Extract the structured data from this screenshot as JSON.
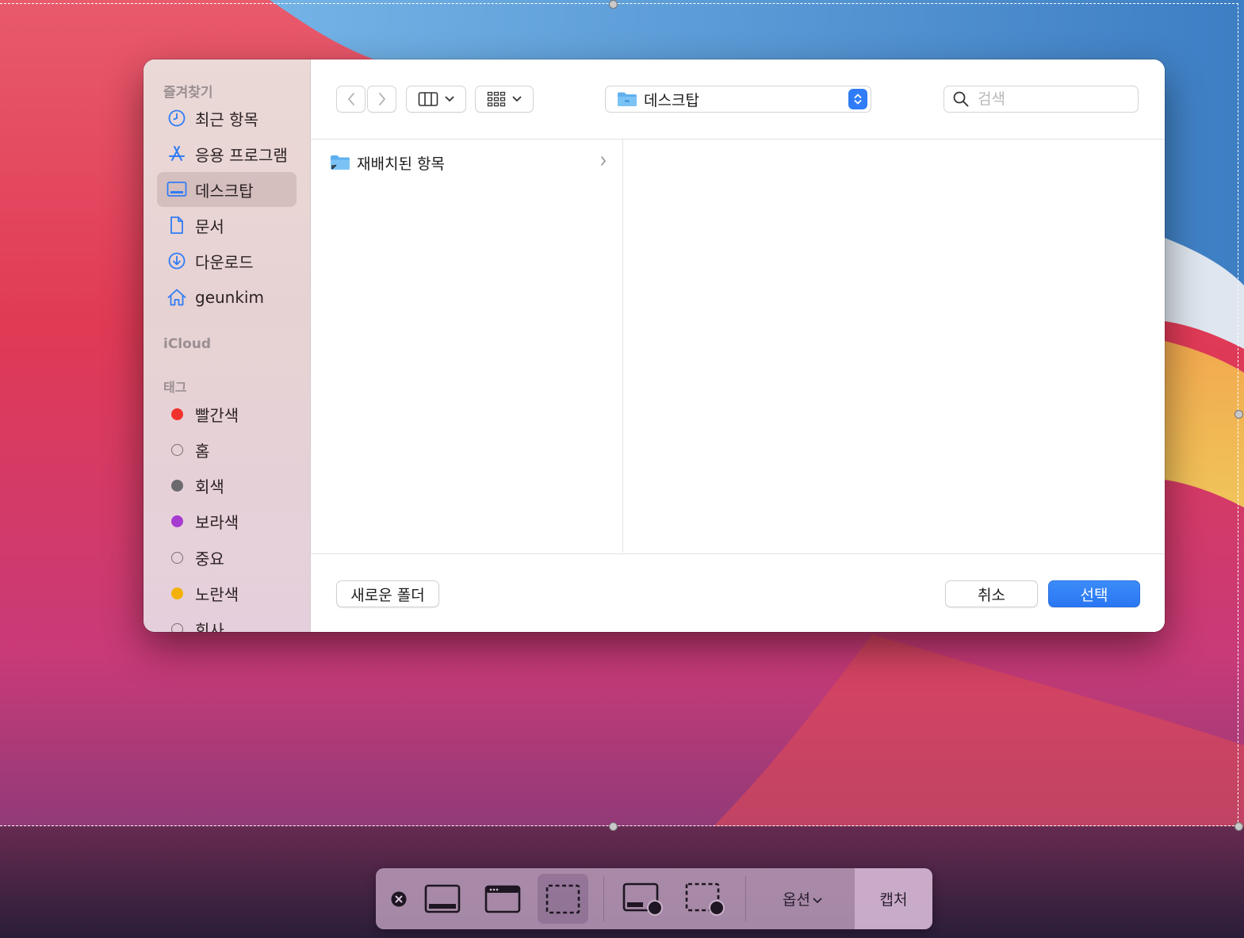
{
  "sidebar": {
    "favorites_header": "즐겨찾기",
    "favorites": [
      {
        "label": "최근 항목",
        "icon": "clock-icon"
      },
      {
        "label": "응용 프로그램",
        "icon": "app-store-icon"
      },
      {
        "label": "데스크탑",
        "icon": "desktop-icon",
        "selected": true
      },
      {
        "label": "문서",
        "icon": "document-icon"
      },
      {
        "label": "다운로드",
        "icon": "download-icon"
      },
      {
        "label": "geunkim",
        "icon": "home-icon"
      }
    ],
    "icloud_header": "iCloud",
    "tags_header": "태그",
    "tags": [
      {
        "label": "빨간색",
        "color": "#f0322c"
      },
      {
        "label": "홈",
        "color": ""
      },
      {
        "label": "회색",
        "color": "#6b6a6f"
      },
      {
        "label": "보라색",
        "color": "#a63bd0"
      },
      {
        "label": "중요",
        "color": ""
      },
      {
        "label": "노란색",
        "color": "#f2b104"
      },
      {
        "label": "회사",
        "color": ""
      }
    ]
  },
  "toolbar": {
    "path_label": "데스크탑",
    "search_placeholder": "검색"
  },
  "browser": {
    "items": [
      {
        "label": "재배치된 항목",
        "icon": "folder-alias-icon"
      }
    ]
  },
  "footer": {
    "new_folder": "새로운 폴더",
    "cancel": "취소",
    "choose": "선택"
  },
  "screenshot_toolbar": {
    "options": "옵션",
    "capture": "캡처"
  },
  "colors": {
    "accent": "#2f7cf6"
  }
}
